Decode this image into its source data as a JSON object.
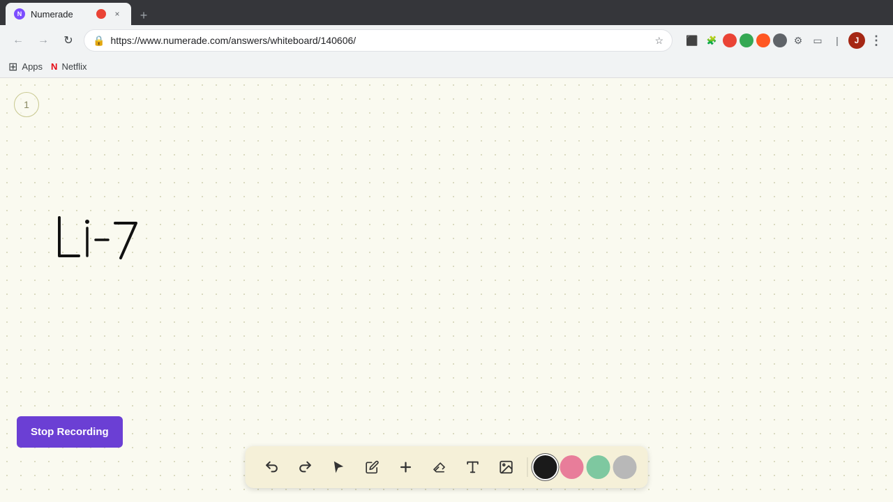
{
  "browser": {
    "tab": {
      "favicon_label": "N",
      "title": "Numerade",
      "close_label": "×",
      "new_tab_label": "+"
    },
    "nav": {
      "back_icon": "←",
      "forward_icon": "→",
      "refresh_icon": "↻",
      "url": "https://www.numerade.com/answers/whiteboard/140606/",
      "star_icon": "☆",
      "menu_icon": "⋮"
    },
    "bookmarks": [
      {
        "icon": "⊞",
        "label": "Apps"
      },
      {
        "icon": "N",
        "label": "Netflix"
      }
    ]
  },
  "whiteboard": {
    "page_number": "1",
    "background_color": "#fafaf0"
  },
  "toolbar": {
    "undo_label": "↺",
    "redo_label": "↻",
    "select_label": "▶",
    "pencil_label": "✏",
    "add_label": "+",
    "eraser_label": "/",
    "text_label": "A",
    "image_label": "▣",
    "colors": [
      {
        "name": "black",
        "value": "#1a1a1a",
        "active": true
      },
      {
        "name": "pink",
        "value": "#e87d9a",
        "active": false
      },
      {
        "name": "green",
        "value": "#7ec8a0",
        "active": false
      },
      {
        "name": "gray",
        "value": "#b0b0b0",
        "active": false
      }
    ]
  },
  "stop_recording": {
    "label": "Stop Recording"
  }
}
